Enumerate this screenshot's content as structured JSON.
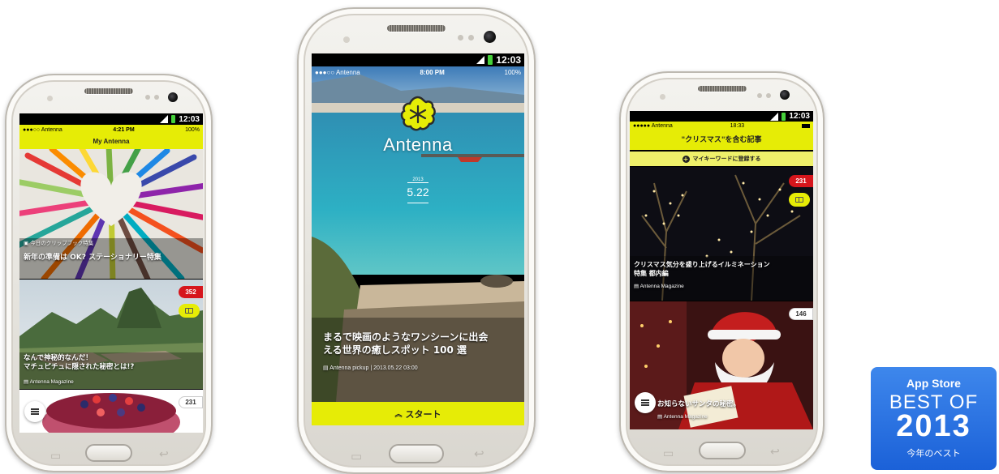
{
  "phone_left": {
    "android_time": "12:03",
    "ios_status": {
      "carrier": "●●●○○ Antenna",
      "time": "4:21 PM",
      "battery": "100%"
    },
    "header_title": "My Antenna",
    "cards": [
      {
        "tag": "今日のクリップブック特集",
        "caption": "新年の準備は OK? ステーショナリー特集"
      },
      {
        "caption_line1": "なんで神秘的なんだ！",
        "caption_line2": "マチュピチュに隠された秘密とは!?",
        "source": "Antenna Magazine",
        "count": "352"
      },
      {
        "count": "231"
      }
    ],
    "icons": {
      "clip": "book-icon",
      "menu": "hamburger-icon"
    }
  },
  "phone_center": {
    "android_time": "12:03",
    "ios_status": {
      "carrier": "●●●○○ Antenna",
      "time": "8:00 PM",
      "battery": "100%"
    },
    "brand": "Antenna",
    "date_year": "2013",
    "date_md": "5.22",
    "headline_line1": "まるで映画のようなワンシーンに出会",
    "headline_line2": "える世界の癒しスポット 100 選",
    "source": "Antenna pickup | 2013.05.22 03:00",
    "start_label": "スタート",
    "icons": {
      "logo": "asterisk-flower-icon",
      "start": "chevron-up-icon"
    }
  },
  "phone_right": {
    "android_time": "12:03",
    "ios_status": {
      "carrier": "●●●●● Antenna",
      "time": "18:33"
    },
    "header_title": "\"クリスマス\"を含む記事",
    "register_label": "マイキーワードに登録する",
    "cards": [
      {
        "caption_line1": "クリスマス気分を盛り上げるイルミネーション",
        "caption_line2": "特集 都内編",
        "source": "Antenna Magazine",
        "count": "231"
      },
      {
        "caption": "お知らないサンタの秘密。",
        "source": "Antenna Magazine",
        "count": "146"
      }
    ]
  },
  "badge": {
    "line1": "App Store",
    "line2": "BEST OF",
    "line3": "2013",
    "line4": "今年のベスト"
  },
  "colors": {
    "accent_yellow": "#e6ec06",
    "badge_red": "#d6161c",
    "badge_blue": "#2a72e0"
  }
}
